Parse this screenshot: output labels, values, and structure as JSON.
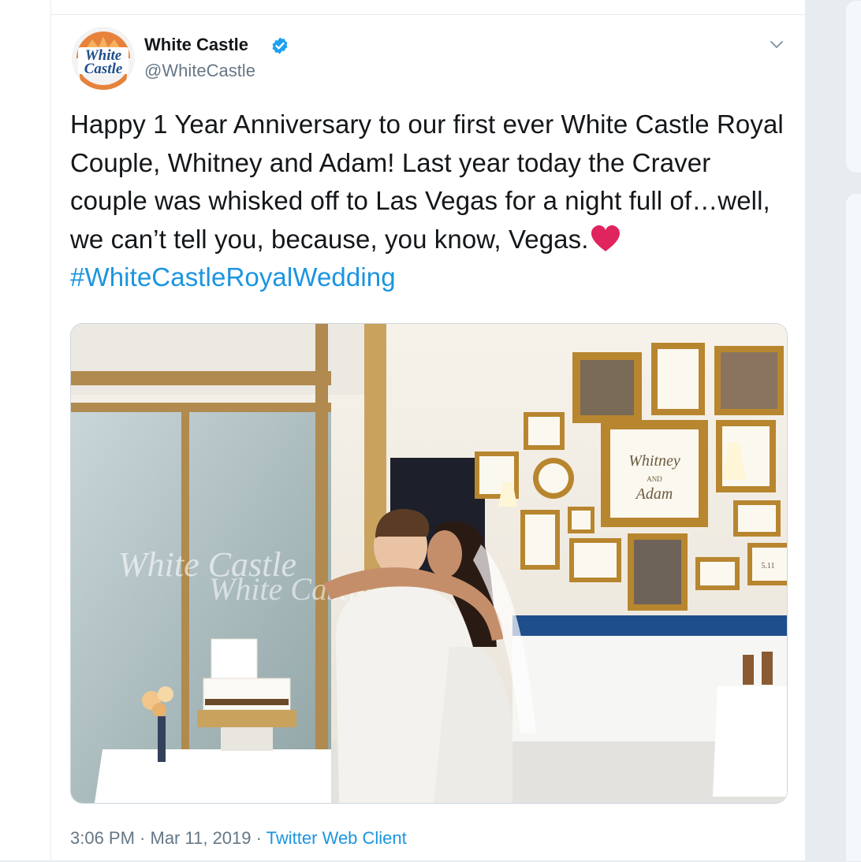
{
  "tweet": {
    "author": {
      "name": "White Castle",
      "handle": "@WhiteCastle",
      "avatar_text_top": "White",
      "avatar_text_bottom": "Castle"
    },
    "text_main": "Happy 1 Year Anniversary to our first ever White Castle Royal Couple, Whitney and Adam! Last year today the Craver couple was whisked off to Las Vegas for a night full of…well, we can’t tell you, because, you know, Vegas.",
    "hashtag": "#WhiteCastleRoyalWedding",
    "time": "3:06 PM",
    "separator": " · ",
    "date": "Mar 11, 2019",
    "source": "Twitter Web Client",
    "photo_signs": {
      "framed_names_top": "Whitney",
      "framed_names_mid": "AND",
      "framed_names_bottom": "Adam",
      "window_text": "White Castle",
      "number_sign": "5.11"
    }
  },
  "colors": {
    "link": "#1b95e0",
    "verified": "#1da1f2",
    "heart": "#e0245e",
    "muted": "#657786"
  },
  "icons": [
    "verified-badge-icon",
    "chevron-down-icon",
    "heart-emoji-icon"
  ]
}
